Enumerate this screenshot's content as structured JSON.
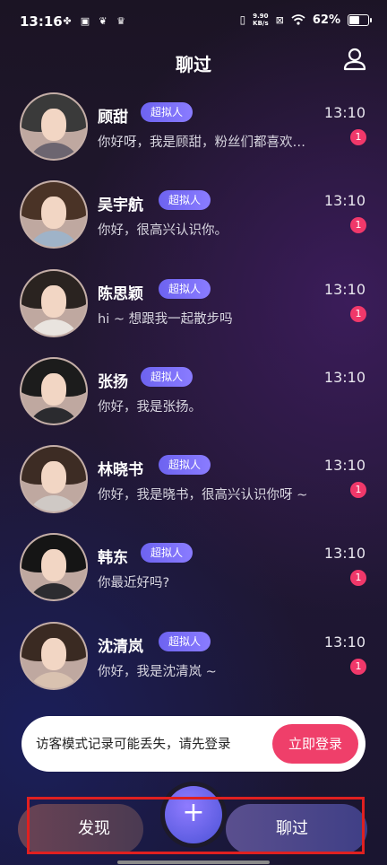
{
  "status_bar": {
    "time": "13:16",
    "net_speed_value": "9.90",
    "net_speed_unit": "KB/s",
    "battery": "62%",
    "battery_level": 0.62
  },
  "header": {
    "title": "聊过"
  },
  "conversations": [
    {
      "name": "顾甜",
      "badge": "超拟人",
      "time": "13:10",
      "message": "你好呀，我是顾甜，粉丝们都喜欢…",
      "unread": "1"
    },
    {
      "name": "吴宇航",
      "badge": "超拟人",
      "time": "13:10",
      "message": "你好，很高兴认识你。",
      "unread": "1"
    },
    {
      "name": "陈思颖",
      "badge": "超拟人",
      "time": "13:10",
      "message": "hi ~ 想跟我一起散步吗",
      "unread": "1"
    },
    {
      "name": "张扬",
      "badge": "超拟人",
      "time": "13:10",
      "message": "你好，我是张扬。",
      "unread": ""
    },
    {
      "name": "林晓书",
      "badge": "超拟人",
      "time": "13:10",
      "message": "你好，我是晓书，很高兴认识你呀 ~",
      "unread": "1"
    },
    {
      "name": "韩东",
      "badge": "超拟人",
      "time": "13:10",
      "message": "你最近好吗?",
      "unread": "1"
    },
    {
      "name": "沈清岚",
      "badge": "超拟人",
      "time": "13:10",
      "message": "你好，我是沈清岚 ~",
      "unread": "1"
    }
  ],
  "toast": {
    "text": "访客模式记录可能丢失，请先登录",
    "button": "立即登录"
  },
  "bottom_nav": {
    "discover": "发现",
    "plus": "+",
    "chat": "聊过"
  }
}
